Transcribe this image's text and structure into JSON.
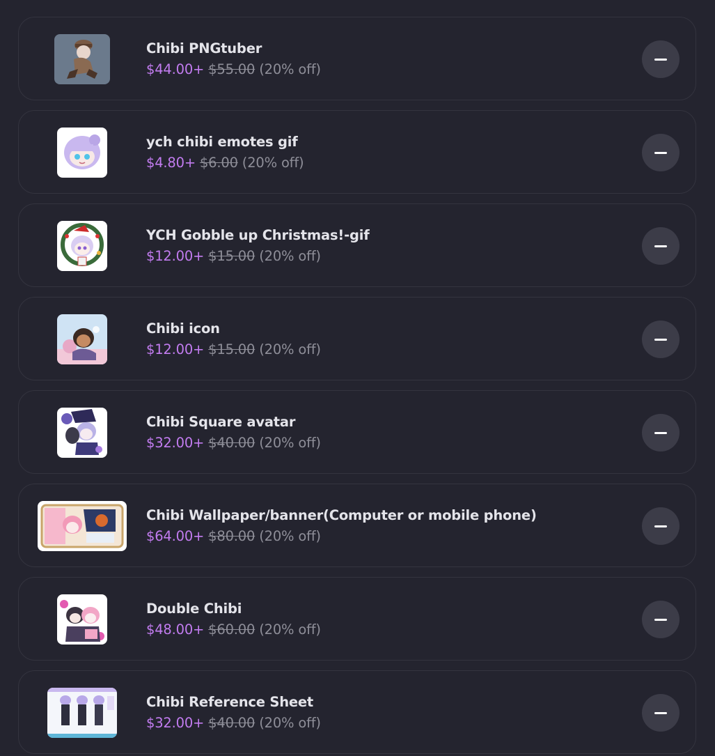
{
  "cart": {
    "items": [
      {
        "title": "Chibi PNGtuber",
        "price": "$44.00+",
        "original": "$55.00",
        "discount": "(20% off)",
        "image": "chibi-pngtuber-thumbnail"
      },
      {
        "title": "ych chibi emotes gif",
        "price": "$4.80+",
        "original": "$6.00",
        "discount": "(20% off)",
        "image": "chibi-emotes-thumbnail"
      },
      {
        "title": "YCH Gobble up Christmas!-gif",
        "price": "$12.00+",
        "original": "$15.00",
        "discount": "(20% off)",
        "image": "christmas-gif-thumbnail"
      },
      {
        "title": "Chibi icon",
        "price": "$12.00+",
        "original": "$15.00",
        "discount": "(20% off)",
        "image": "chibi-icon-thumbnail"
      },
      {
        "title": "Chibi Square avatar",
        "price": "$32.00+",
        "original": "$40.00",
        "discount": "(20% off)",
        "image": "square-avatar-thumbnail"
      },
      {
        "title": "Chibi Wallpaper/banner(Computer or mobile phone)",
        "price": "$64.00+",
        "original": "$80.00",
        "discount": "(20% off)",
        "image": "wallpaper-banner-thumbnail"
      },
      {
        "title": "Double Chibi",
        "price": "$48.00+",
        "original": "$60.00",
        "discount": "(20% off)",
        "image": "double-chibi-thumbnail"
      },
      {
        "title": "Chibi Reference Sheet",
        "price": "$32.00+",
        "original": "$40.00",
        "discount": "(20% off)",
        "image": "reference-sheet-thumbnail"
      }
    ],
    "remove_icon": "minus-icon",
    "colors": {
      "background": "#24242f",
      "card_border": "#34343f",
      "title": "#e4e4ea",
      "price": "#c27cf0",
      "muted": "#8e8e98",
      "button": "#3c3c48"
    }
  }
}
